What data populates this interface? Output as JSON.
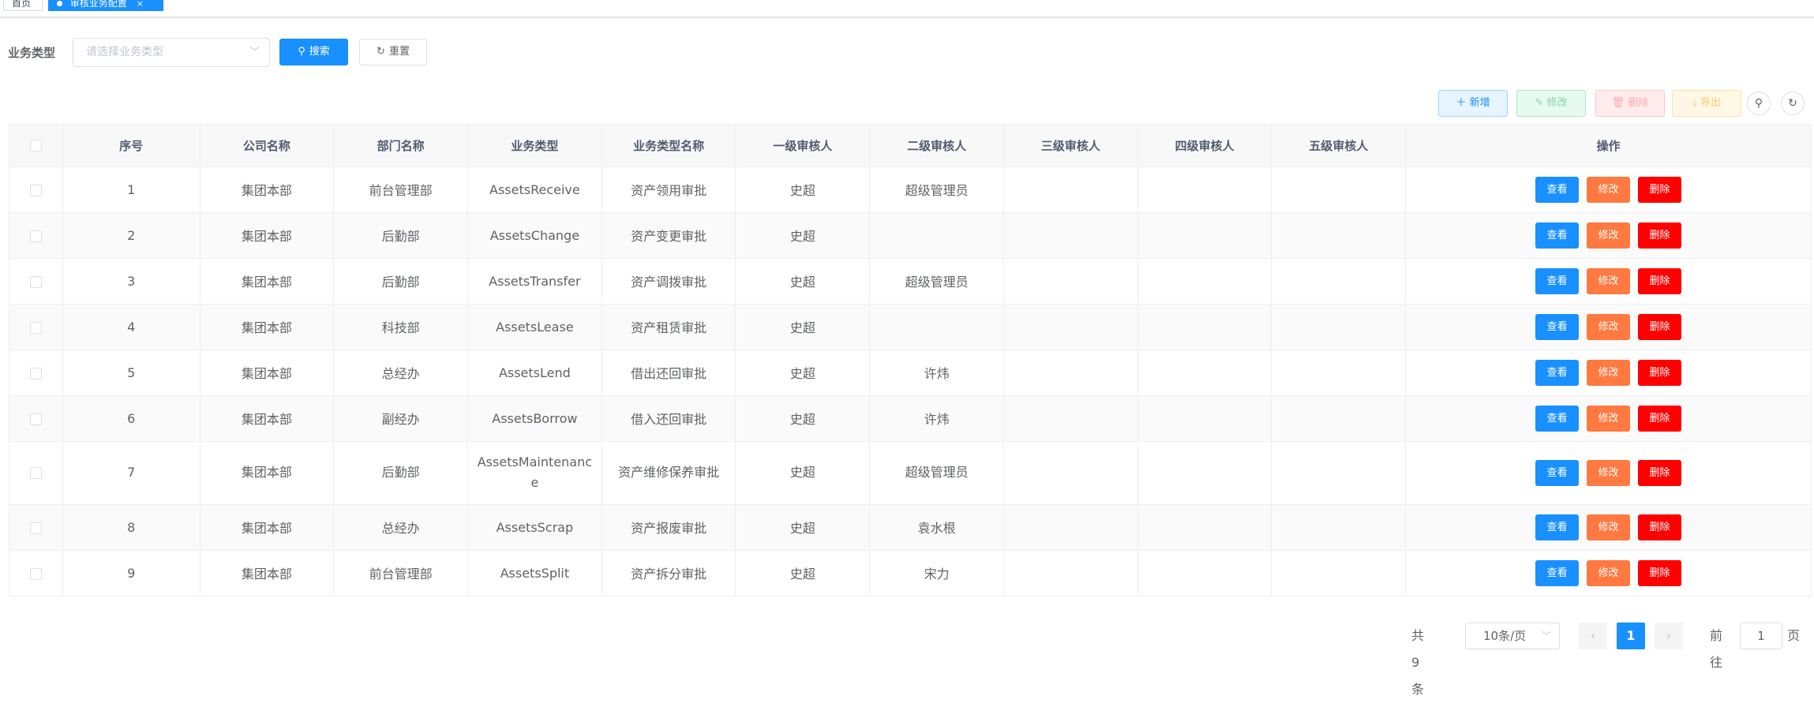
{
  "tags": {
    "home": "首页",
    "active": "审核业务配置",
    "active_close": "×"
  },
  "search": {
    "label": "业务类型",
    "select_placeholder": "请选择业务类型",
    "search_button": "搜索",
    "reset_button": "重置"
  },
  "toolbar": {
    "add": "新增",
    "edit": "修改",
    "delete": "删除",
    "export": "导出"
  },
  "table": {
    "headers": [
      "序号",
      "公司名称",
      "部门名称",
      "业务类型",
      "业务类型名称",
      "一级审核人",
      "二级审核人",
      "三级审核人",
      "四级审核人",
      "五级审核人",
      "操作"
    ],
    "rows": [
      [
        "1",
        "集团本部",
        "前台管理部",
        "AssetsReceive",
        "资产领用审批",
        "史超",
        "超级管理员",
        "",
        "",
        ""
      ],
      [
        "2",
        "集团本部",
        "后勤部",
        "AssetsChange",
        "资产变更审批",
        "史超",
        "",
        "",
        "",
        ""
      ],
      [
        "3",
        "集团本部",
        "后勤部",
        "AssetsTransfer",
        "资产调拨审批",
        "史超",
        "超级管理员",
        "",
        "",
        ""
      ],
      [
        "4",
        "集团本部",
        "科技部",
        "AssetsLease",
        "资产租赁审批",
        "史超",
        "",
        "",
        "",
        ""
      ],
      [
        "5",
        "集团本部",
        "总经办",
        "AssetsLend",
        "借出还回审批",
        "史超",
        "许炜",
        "",
        "",
        ""
      ],
      [
        "6",
        "集团本部",
        "副经办",
        "AssetsBorrow",
        "借入还回审批",
        "史超",
        "许炜",
        "",
        "",
        ""
      ],
      [
        "7",
        "集团本部",
        "后勤部",
        "AssetsMaintenance",
        "资产维修保养审批",
        "史超",
        "超级管理员",
        "",
        "",
        ""
      ],
      [
        "8",
        "集团本部",
        "总经办",
        "AssetsScrap",
        "资产报废审批",
        "史超",
        "袁水根",
        "",
        "",
        ""
      ],
      [
        "9",
        "集团本部",
        "前台管理部",
        "AssetsSplit",
        "资产拆分审批",
        "史超",
        "宋力",
        "",
        "",
        ""
      ]
    ],
    "actions": {
      "view": "查看",
      "edit": "修改",
      "delete": "删除"
    }
  },
  "pagination": {
    "total": "共 9 条",
    "page_size": "10条/页",
    "current_page": "1",
    "goto_label": "前往",
    "goto_value": "1",
    "goto_unit": "页"
  }
}
